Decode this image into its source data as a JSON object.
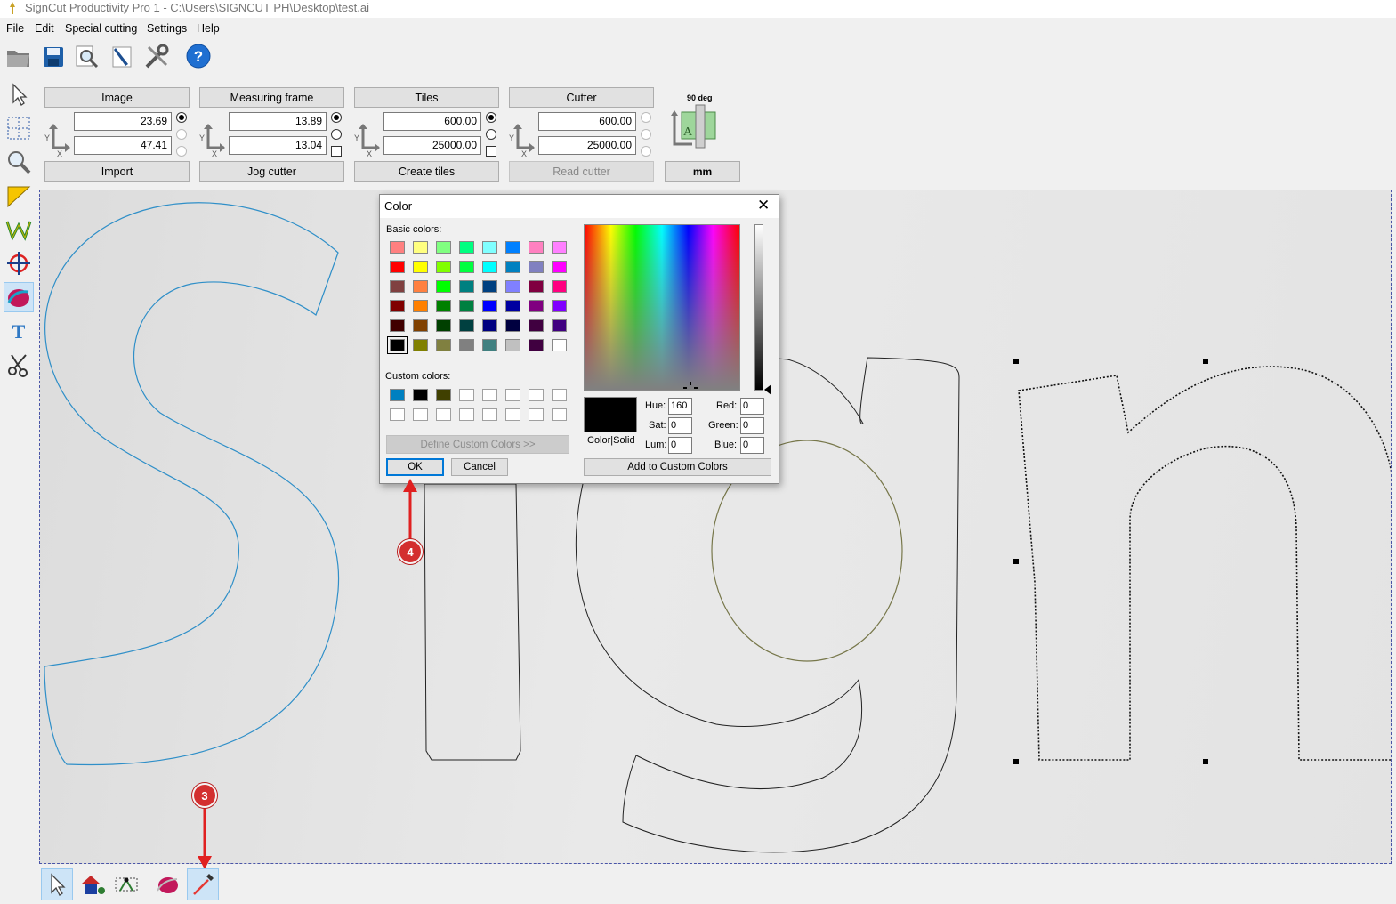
{
  "window": {
    "title": "SignCut Productivity Pro 1 - C:\\Users\\SIGNCUT PH\\Desktop\\test.ai"
  },
  "menu": [
    "File",
    "Edit",
    "Special cutting",
    "Settings",
    "Help"
  ],
  "toolbar_icons": [
    "open-folder-icon",
    "save-icon",
    "preview-icon",
    "knife-icon",
    "tools-icon",
    "help-icon"
  ],
  "left_tools": [
    "select-arrow-icon",
    "grid-select-icon",
    "zoom-icon",
    "ruler-icon",
    "weed-icon",
    "registration-mark-icon",
    "color-layer-icon",
    "text-icon",
    "scissors-icon"
  ],
  "panels": {
    "image": {
      "header": "Image",
      "x": "23.69",
      "y": "47.41",
      "footer": "Import"
    },
    "measuring_frame": {
      "header": "Measuring frame",
      "x": "13.89",
      "y": "13.04",
      "footer": "Jog cutter"
    },
    "tiles": {
      "header": "Tiles",
      "x": "600.00",
      "y": "25000.00",
      "footer": "Create tiles"
    },
    "cutter": {
      "header": "Cutter",
      "x": "600.00",
      "y": "25000.00",
      "footer": "Read cutter"
    }
  },
  "orientation": {
    "label": "90 deg",
    "unit": "mm"
  },
  "dialog": {
    "title": "Color",
    "basic_label": "Basic colors:",
    "custom_label": "Custom colors:",
    "define_label": "Define Custom Colors >>",
    "ok_label": "OK",
    "cancel_label": "Cancel",
    "add_label": "Add to Custom Colors",
    "colorsolid_label": "Color|Solid",
    "hue_label": "Hue:",
    "hue": "160",
    "sat_label": "Sat:",
    "sat": "0",
    "lum_label": "Lum:",
    "lum": "0",
    "red_label": "Red:",
    "red": "0",
    "green_label": "Green:",
    "green": "0",
    "blue_label": "Blue:",
    "blue": "0",
    "basic_colors": [
      [
        "#ff8080",
        "#ffff80",
        "#80ff80",
        "#00ff80",
        "#80ffff",
        "#0080ff",
        "#ff80c0",
        "#ff80ff"
      ],
      [
        "#ff0000",
        "#ffff00",
        "#80ff00",
        "#00ff40",
        "#00ffff",
        "#0080c0",
        "#8080c0",
        "#ff00ff"
      ],
      [
        "#804040",
        "#ff8040",
        "#00ff00",
        "#008080",
        "#004080",
        "#8080ff",
        "#800040",
        "#ff0080"
      ],
      [
        "#800000",
        "#ff8000",
        "#008000",
        "#008040",
        "#0000ff",
        "#0000a0",
        "#800080",
        "#8000ff"
      ],
      [
        "#400000",
        "#804000",
        "#004000",
        "#004040",
        "#000080",
        "#000040",
        "#400040",
        "#400080"
      ],
      [
        "#000000",
        "#808000",
        "#808040",
        "#808080",
        "#408080",
        "#c0c0c0",
        "#400040",
        "#ffffff"
      ]
    ],
    "custom_colors": [
      [
        "#0080c0",
        "#000000",
        "#404000",
        "",
        "",
        "",
        "",
        ""
      ],
      [
        "",
        "",
        "",
        "",
        "",
        "",
        "",
        ""
      ]
    ]
  },
  "callouts": {
    "three": "3",
    "four": "4"
  },
  "bottom_tools": [
    "pointer-icon",
    "shapes-icon",
    "node-edit-icon",
    "color-layer-icon",
    "eyedropper-icon"
  ]
}
